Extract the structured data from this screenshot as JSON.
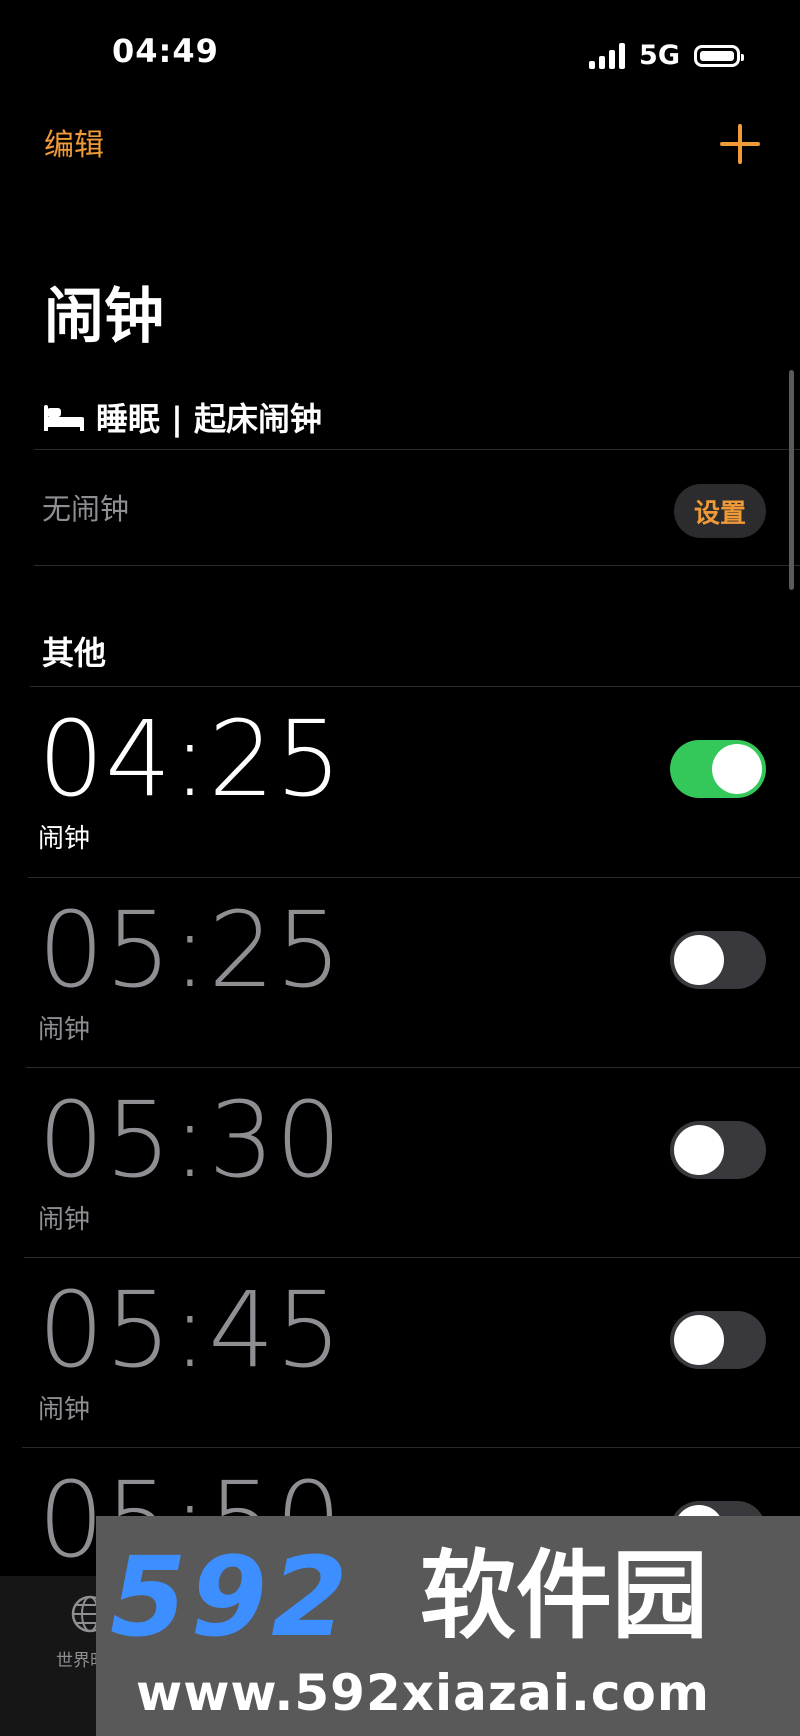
{
  "status_bar": {
    "time": "04:49",
    "network": "5G"
  },
  "nav": {
    "edit_label": "编辑"
  },
  "page": {
    "title": "闹钟"
  },
  "sleep": {
    "header": "睡眠 | 起床闹钟",
    "empty_label": "无闹钟",
    "setup_label": "设置"
  },
  "other_section": {
    "title": "其他"
  },
  "alarms": [
    {
      "time": "04:25",
      "label": "闹钟",
      "enabled": true
    },
    {
      "time": "05:25",
      "label": "闹钟",
      "enabled": false
    },
    {
      "time": "05:30",
      "label": "闹钟",
      "enabled": false
    },
    {
      "time": "05:45",
      "label": "闹钟",
      "enabled": false
    },
    {
      "time": "05:50",
      "label": "",
      "enabled": false
    }
  ],
  "tab_bar": {
    "world_clock_label": "世界时钟"
  },
  "watermark": {
    "logo": "592",
    "text": "软件园",
    "url": "www.592xiazai.com"
  },
  "colors": {
    "accent": "#f09a37",
    "toggle_on": "#34c759",
    "background": "#000000"
  }
}
